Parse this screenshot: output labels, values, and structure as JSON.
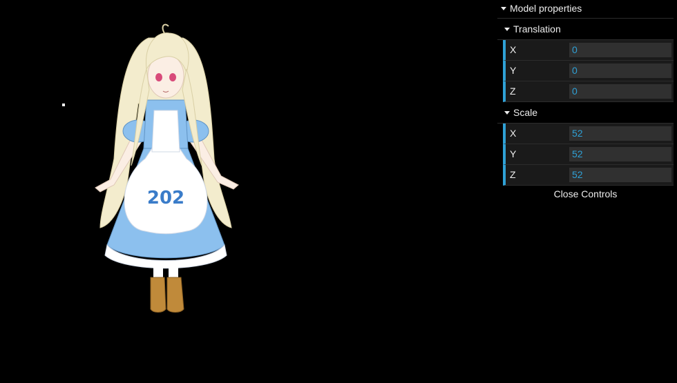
{
  "gui": {
    "model_folder": "Model properties",
    "translation": {
      "title": "Translation",
      "x_label": "X",
      "x_value": "0",
      "y_label": "Y",
      "y_value": "0",
      "z_label": "Z",
      "z_value": "0"
    },
    "scale": {
      "title": "Scale",
      "x_label": "X",
      "x_value": "52",
      "y_label": "Y",
      "y_value": "52",
      "z_label": "Z",
      "z_value": "52"
    },
    "close_label": "Close Controls"
  },
  "scene": {
    "apron_number": "202"
  },
  "colors": {
    "background": "#000000",
    "accent": "#2fa1d6",
    "field_bg": "#303030",
    "row_bg": "#1a1a1a",
    "text": "#eeeeee",
    "dress": "#8cc0ee",
    "hair": "#f3eccd",
    "boots": "#c08a3a"
  }
}
